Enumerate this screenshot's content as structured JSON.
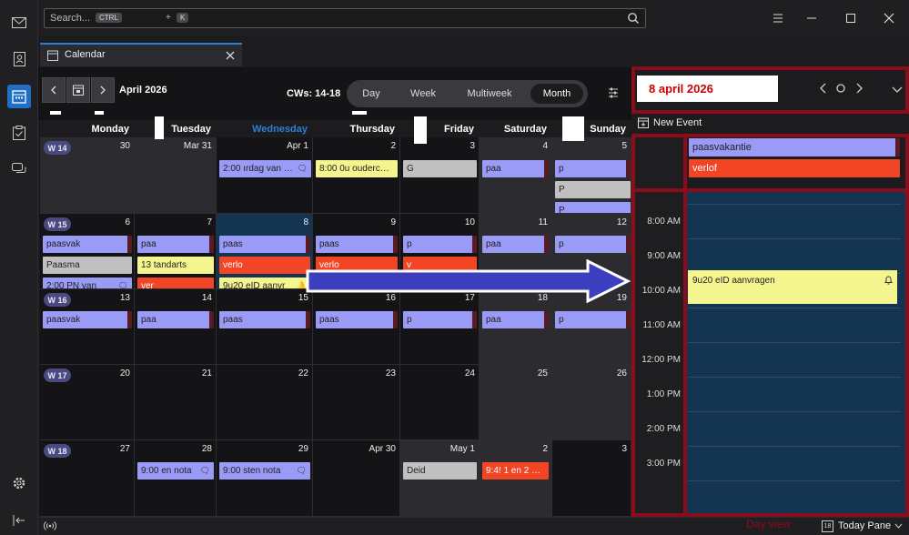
{
  "app": {
    "search_placeholder": "Search...",
    "search_key_ctrl": "CTRL",
    "search_key_plus": "+",
    "search_key_k": "K"
  },
  "tab": {
    "label": "Calendar"
  },
  "toolbar": {
    "month_label": "April 2026",
    "cws_label": "CWs: 14-18",
    "views": [
      "Day",
      "Week",
      "Multiweek",
      "Month"
    ],
    "active_view": "Month"
  },
  "weekdays": [
    "Monday",
    "Tuesday",
    "Wednesday",
    "Thursday",
    "Friday",
    "Saturday",
    "Sunday"
  ],
  "weeks": [
    {
      "label": "W 14",
      "days": [
        "30",
        "Mar 31",
        "Apr 1",
        "2",
        "3",
        "4",
        "5"
      ]
    },
    {
      "label": "W 15",
      "days": [
        "6",
        "7",
        "8",
        "9",
        "10",
        "11",
        "12"
      ]
    },
    {
      "label": "W 16",
      "days": [
        "13",
        "14",
        "15",
        "16",
        "17",
        "18",
        "19"
      ]
    },
    {
      "label": "W 17",
      "days": [
        "20",
        "21",
        "22",
        "23",
        "24",
        "25",
        "26"
      ]
    },
    {
      "label": "W 18",
      "days": [
        "27",
        "28",
        "29",
        "Apr 30",
        "May 1",
        "2",
        "3"
      ]
    }
  ],
  "events": {
    "w14_wed": "2:00 ırdag van …",
    "w14_thu": "8:00 0u ouderc…",
    "w14_fri": "G",
    "w14_sat": "paa",
    "w14_sun1": "p",
    "w14_sun2": "P",
    "w14_sun3": "P",
    "w15_mon1": "paasvak",
    "w15_mon2": "Paasma",
    "w15_mon3": "2:00 PN van",
    "w15_tue1": "paa",
    "w15_tue2": "13 tandarts",
    "w15_tue3": "ver",
    "w15_wed1": "paas",
    "w15_wed2": "verlo",
    "w15_wed3": "9u20 eID aanvr",
    "w15_thu1": "paas",
    "w15_thu2": "verlo",
    "w15_fri1": "p",
    "w15_fri2": "v",
    "w15_sat": "paa",
    "w15_sun": "p",
    "w16_mon": "paasvak",
    "w16_tue": "paa",
    "w16_wed": "paas",
    "w16_thu": "paas",
    "w16_fri": "p",
    "w16_sat": "paa",
    "w16_sun": "p",
    "w18_tue": "9:00 en nota",
    "w18_wed": "9:00 sten nota",
    "w18_fri": "Deid",
    "w18_sat": "9:4! 1 en 2 …"
  },
  "day_pane": {
    "date_title": "8 april 2026",
    "new_event": "New Event",
    "allday": [
      "paasvakantie",
      "verlof"
    ],
    "hours": [
      "8:00 AM",
      "9:00 AM",
      "10:00 AM",
      "11:00 AM",
      "12:00 PM",
      "1:00 PM",
      "2:00 PM",
      "3:00 PM"
    ],
    "event": "9u20 eID aanvragen",
    "caption": "Day view"
  },
  "status": {
    "today_pane": "Today Pane",
    "today_icon_num": "18"
  },
  "colors": {
    "accent": "#2b7fd6",
    "highlight_red": "#8b0d1c",
    "event_purple": "#9a9af7",
    "event_red": "#f24526",
    "event_yellow": "#f5f590",
    "event_gray": "#c0c0c0",
    "arrow_blue": "#3b3fbf"
  }
}
